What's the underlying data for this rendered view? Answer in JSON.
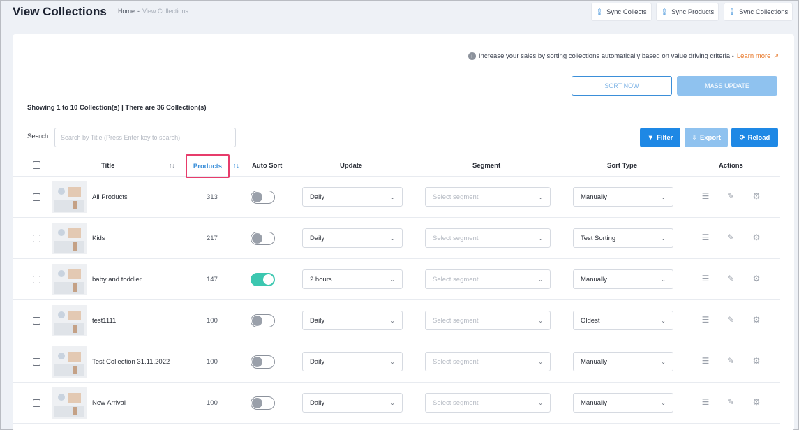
{
  "header": {
    "title": "View Collections",
    "breadcrumb": {
      "home": "Home",
      "separator": "-",
      "current": "View Collections"
    },
    "sync_buttons": [
      "Sync Collects",
      "Sync Products",
      "Sync Collections"
    ]
  },
  "info": {
    "text": "Increase your sales by sorting collections automatically based on value driving criteria -",
    "link": "Learn more"
  },
  "buttons": {
    "sort_now": "SORT NOW",
    "mass_update": "MASS UPDATE",
    "filter": "Filter",
    "export": "Export",
    "reload": "Reload"
  },
  "showing": "Showing 1 to 10 Collection(s) | There are 36 Collection(s)",
  "search": {
    "label": "Search:",
    "placeholder": "Search by Title (Press Enter key to search)"
  },
  "columns": {
    "title": "Title",
    "products": "Products",
    "auto_sort": "Auto Sort",
    "update": "Update",
    "segment": "Segment",
    "sort_type": "Sort Type",
    "actions": "Actions"
  },
  "rows": [
    {
      "title": "All Products",
      "products": "313",
      "auto_sort": false,
      "update": "Daily",
      "segment": "Select segment",
      "sort_type": "Manually"
    },
    {
      "title": "Kids",
      "products": "217",
      "auto_sort": false,
      "update": "Daily",
      "segment": "Select segment",
      "sort_type": "Test Sorting"
    },
    {
      "title": "baby and toddler",
      "products": "147",
      "auto_sort": true,
      "update": "2 hours",
      "segment": "Select segment",
      "sort_type": "Manually"
    },
    {
      "title": "test1111",
      "products": "100",
      "auto_sort": false,
      "update": "Daily",
      "segment": "Select segment",
      "sort_type": "Oldest"
    },
    {
      "title": "Test Collection 31.11.2022",
      "products": "100",
      "auto_sort": false,
      "update": "Daily",
      "segment": "Select segment",
      "sort_type": "Manually"
    },
    {
      "title": "New Arrival",
      "products": "100",
      "auto_sort": false,
      "update": "Daily",
      "segment": "Select segment",
      "sort_type": "Manually"
    }
  ],
  "colors": {
    "primary": "#1e88e5",
    "primary_light": "#8fc2ef",
    "highlight": "#e73c6b",
    "toggle_on": "#3cc7b0",
    "link": "#e8782a"
  }
}
